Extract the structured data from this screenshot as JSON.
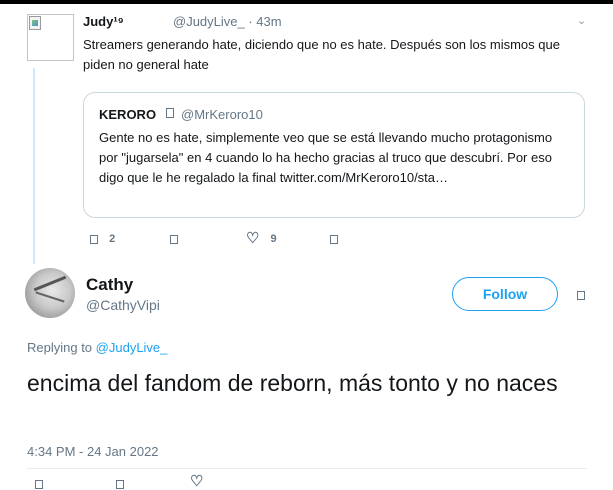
{
  "parent_tweet": {
    "name": "Judy¹⁹",
    "handle_time": "@JudyLive_ · 43m",
    "text": "Streamers generando hate, diciendo que no es hate. Después son los mismos que piden no general hate",
    "quote": {
      "name": "KERORO",
      "handle": "@MrKeroro10",
      "text": "Gente no es hate, simplemente veo que se está llevando mucho protagonismo por \"jugarsela\" en 4 cuando lo ha hecho gracias al truco que descubrí. Por eso digo que le he regalado la final twitter.com/MrKeroro10/sta…"
    },
    "actions": {
      "reply_count": "2",
      "like_count": "9"
    }
  },
  "main_tweet": {
    "name": "Cathy",
    "handle": "@CathyVipi",
    "follow_label": "Follow",
    "replying_prefix": "Replying to ",
    "replying_handle": "@JudyLive_",
    "text": "encima del fandom de reborn, más tonto y no naces",
    "timestamp": "4:34 PM - 24 Jan 2022"
  },
  "icons": {
    "caret": "⌄",
    "heart": "♡"
  },
  "colors": {
    "accent": "#1da1f2",
    "muted": "#657786",
    "thread_line": "#cfe8fb"
  }
}
